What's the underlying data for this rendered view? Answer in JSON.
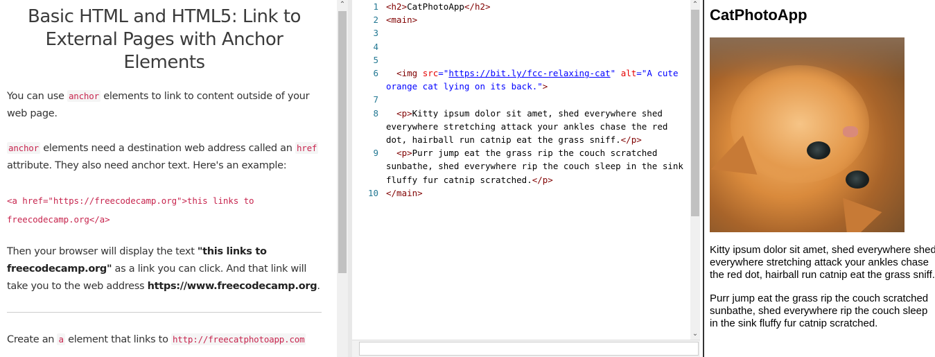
{
  "instructions": {
    "title": "Basic HTML and HTML5: Link to External Pages with Anchor Elements",
    "p1_a": "You can use ",
    "p1_code": "anchor",
    "p1_b": " elements to link to content outside of your web page.",
    "p2_code1": "anchor",
    "p2_a": " elements need a destination web address called an ",
    "p2_code2": "href",
    "p2_b": " attribute. They also need anchor text. Here's an example:",
    "example_code": "<a href=\"https://freecodecamp.org\">this links to freecodecamp.org</a>",
    "p3_a": "Then your browser will display the text ",
    "p3_b1": "\"this links to freecodecamp.org\"",
    "p3_c": " as a link you can click. And that link will take you to the web address ",
    "p3_b2": "https://www.freecodecamp.org",
    "p3_d": ".",
    "p4_a": "Create an ",
    "p4_code1": "a",
    "p4_b": " element that links to ",
    "p4_code2": "http://freecatphotoapp.com"
  },
  "editor": {
    "lines": [
      {
        "n": "1"
      },
      {
        "n": "2"
      },
      {
        "n": "3"
      },
      {
        "n": "4"
      },
      {
        "n": "5"
      },
      {
        "n": "6"
      },
      {
        "n": "7"
      },
      {
        "n": "8"
      },
      {
        "n": "9"
      },
      {
        "n": "10"
      }
    ],
    "l1_open": "<h2>",
    "l1_text": "CatPhotoApp",
    "l1_close": "</h2>",
    "l2": "<main>",
    "l6_tag": "<img",
    "l6_attr1": "src",
    "l6_eq1": "=\"",
    "l6_url": "https://bit.ly/fcc-relaxing-cat",
    "l6_q1": "\"",
    "l6_attr2": "alt",
    "l6_val2": "=\"A cute orange cat lying on its back.\"",
    "l6_end": ">",
    "l8_open": "<p>",
    "l8_text": "Kitty ipsum dolor sit amet, shed everywhere shed everywhere stretching attack your ankles chase the red dot, hairball run catnip eat the grass sniff.",
    "l8_close": "</p>",
    "l9_open": "<p>",
    "l9_text": "Purr jump eat the grass rip the couch scratched sunbathe, shed everywhere rip the couch sleep in the sink fluffy fur catnip scratched.",
    "l9_close": "</p>",
    "l10": "</main>"
  },
  "preview": {
    "heading": "CatPhotoApp",
    "image_alt": "A cute orange cat lying on its back.",
    "p1": "Kitty ipsum dolor sit amet, shed everywhere shed everywhere stretching attack your ankles chase the red dot, hairball run catnip eat the grass sniff.",
    "p2": "Purr jump eat the grass rip the couch scratched sunbathe, shed everywhere rip the couch sleep in the sink fluffy fur catnip scratched."
  },
  "icons": {
    "scroll_up": "chevron-up-icon",
    "scroll_down": "chevron-down-icon"
  }
}
